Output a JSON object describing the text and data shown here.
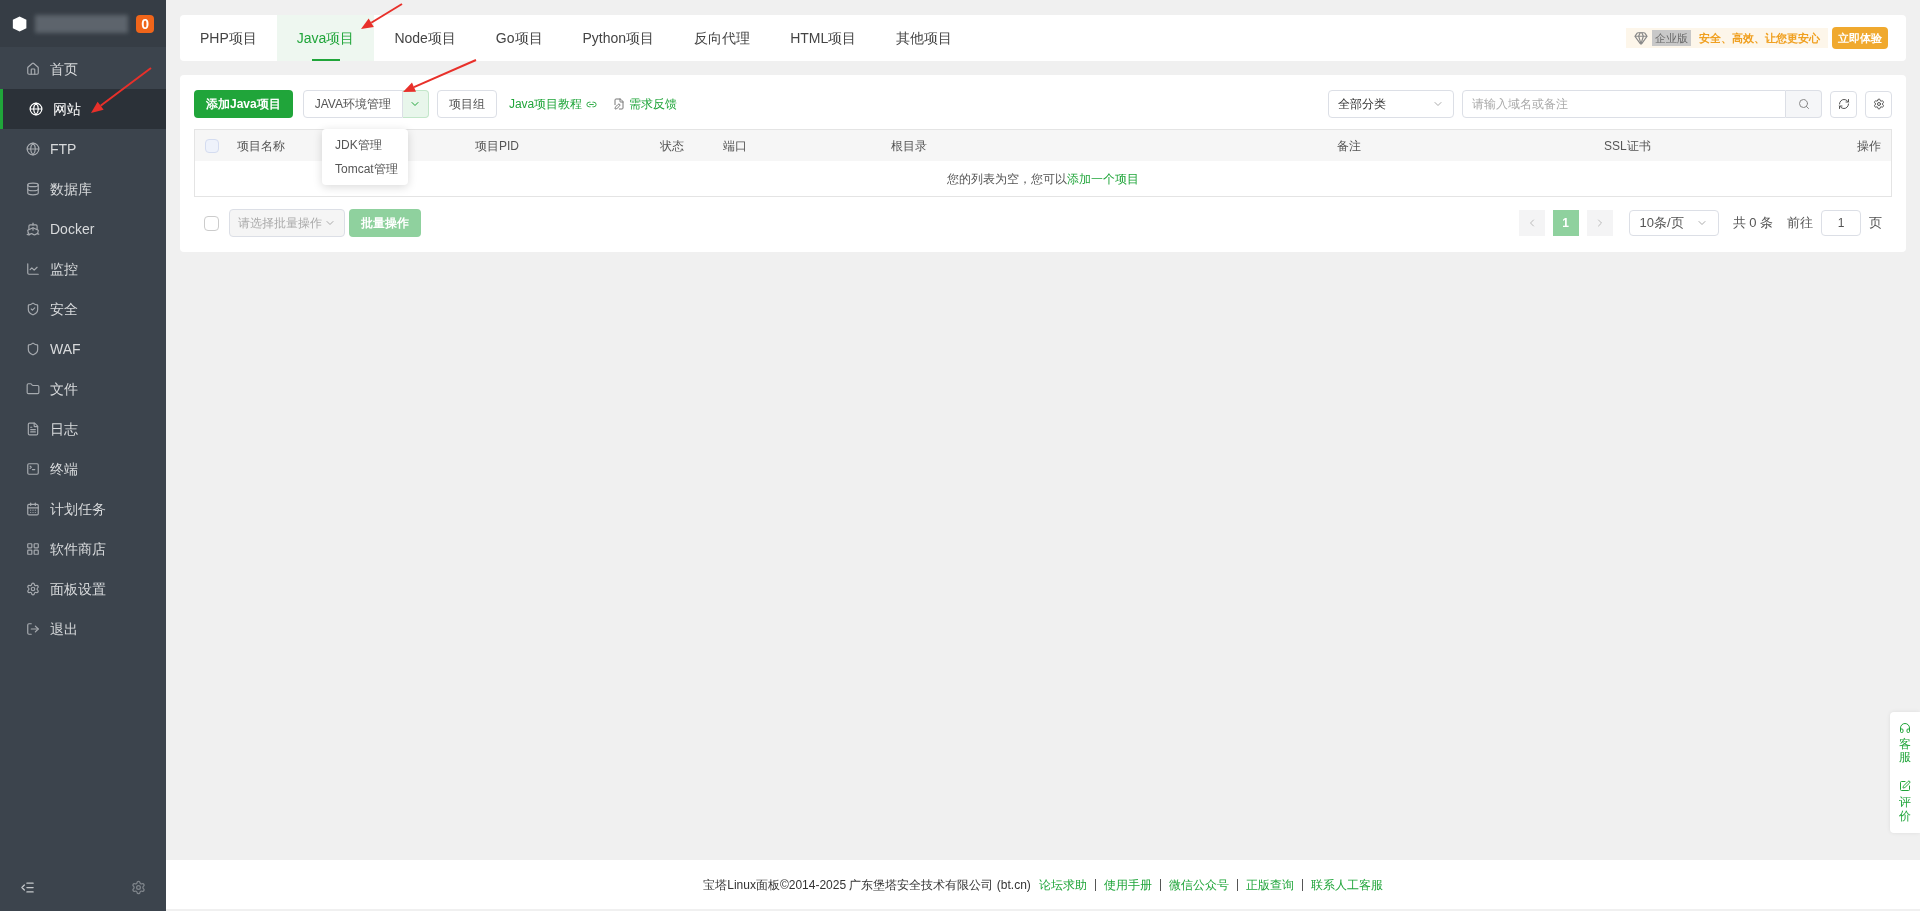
{
  "sidebar": {
    "badge": "0",
    "items": [
      {
        "label": "首页",
        "kind": "home",
        "selected": false
      },
      {
        "label": "网站",
        "kind": "globe",
        "selected": true
      },
      {
        "label": "FTP",
        "kind": "ftp",
        "selected": false
      },
      {
        "label": "数据库",
        "kind": "database",
        "selected": false
      },
      {
        "label": "Docker",
        "kind": "docker",
        "selected": false
      },
      {
        "label": "监控",
        "kind": "monitor",
        "selected": false
      },
      {
        "label": "安全",
        "kind": "shield",
        "selected": false
      },
      {
        "label": "WAF",
        "kind": "waf",
        "selected": false
      },
      {
        "label": "文件",
        "kind": "folder",
        "selected": false
      },
      {
        "label": "日志",
        "kind": "log",
        "selected": false
      },
      {
        "label": "终端",
        "kind": "terminal",
        "selected": false
      },
      {
        "label": "计划任务",
        "kind": "calendar",
        "selected": false
      },
      {
        "label": "软件商店",
        "kind": "grid",
        "selected": false
      },
      {
        "label": "面板设置",
        "kind": "gear",
        "selected": false
      },
      {
        "label": "退出",
        "kind": "logout",
        "selected": false
      }
    ]
  },
  "tabs": [
    {
      "label": "PHP项目",
      "selected": false
    },
    {
      "label": "Java项目",
      "selected": true
    },
    {
      "label": "Node项目",
      "selected": false
    },
    {
      "label": "Go项目",
      "selected": false
    },
    {
      "label": "Python项目",
      "selected": false
    },
    {
      "label": "反向代理",
      "selected": false
    },
    {
      "label": "HTML项目",
      "selected": false
    },
    {
      "label": "其他项目",
      "selected": false
    }
  ],
  "promo": {
    "badge": "企业版",
    "slogan": "安全、高效、让您更安心",
    "button": "立即体验"
  },
  "toolbar": {
    "add_button": "添加Java项目",
    "env_button": "JAVA环境管理",
    "env_menu": [
      "JDK管理",
      "Tomcat管理"
    ],
    "group_button": "项目组",
    "tutorial_link": "Java项目教程",
    "feedback_link": "需求反馈",
    "category": "全部分类",
    "search": {
      "placeholder": "请输入域名或备注"
    }
  },
  "table": {
    "select_all_checked": false,
    "columns": [
      "项目名称",
      "项目PID",
      "状态",
      "端口",
      "根目录",
      "备注",
      "SSL证书",
      "操作"
    ],
    "empty_message": "您的列表为空，您可以",
    "empty_link": "添加一个项目"
  },
  "batch": {
    "checked": false,
    "placeholder": "请选择批量操作",
    "button": "批量操作"
  },
  "pagination": {
    "pages": [
      {
        "label": "1",
        "selected": true
      }
    ],
    "page_size": "10条/页",
    "total": "共 0 条",
    "goto_label": "前往",
    "goto_value": "1",
    "page_unit": "页"
  },
  "footer": {
    "copyright": "宝塔Linux面板©2014-2025 广东堡塔安全技术有限公司 (bt.cn)",
    "links": [
      "论坛求助",
      "使用手册",
      "微信公众号",
      "正版查询",
      "联系人工客服"
    ]
  },
  "float_widget": [
    {
      "label": "客服",
      "kind": "headset"
    },
    {
      "label": "评价",
      "kind": "edit"
    }
  ]
}
